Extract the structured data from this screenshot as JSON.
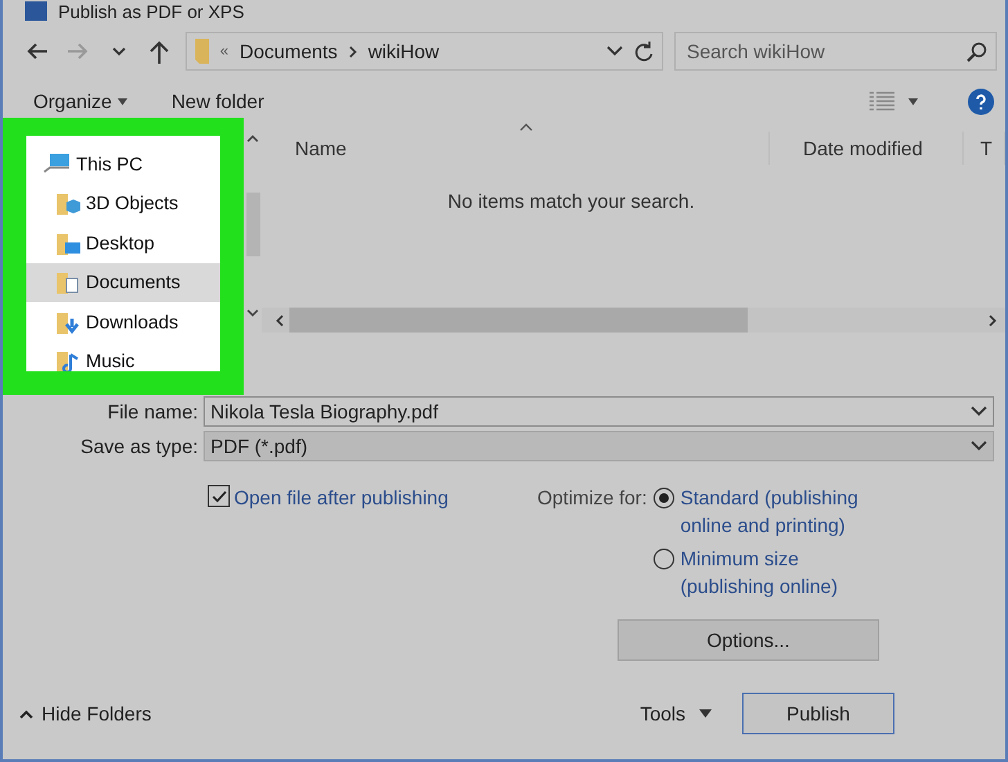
{
  "window": {
    "title": "Publish as PDF or XPS"
  },
  "address_bar": {
    "path": [
      "Documents",
      "wikiHow"
    ],
    "overflow": "«"
  },
  "search": {
    "placeholder": "Search wikiHow"
  },
  "toolbar": {
    "organize": "Organize",
    "new_folder": "New folder"
  },
  "nav_tree": {
    "label": "This PC",
    "children": [
      {
        "label": "3D Objects",
        "kind": "objects3d",
        "selected": false
      },
      {
        "label": "Desktop",
        "kind": "desktop",
        "selected": false
      },
      {
        "label": "Documents",
        "kind": "documents",
        "selected": true
      },
      {
        "label": "Downloads",
        "kind": "downloads",
        "selected": false
      },
      {
        "label": "Music",
        "kind": "music",
        "selected": false
      }
    ]
  },
  "file_list": {
    "columns": [
      "Name",
      "Date modified",
      "T"
    ],
    "empty_message": "No items match your search."
  },
  "file_name": {
    "label": "File name:",
    "value": "Nikola Tesla Biography.pdf"
  },
  "save_as_type": {
    "label": "Save as type:",
    "value": "PDF (*.pdf)"
  },
  "open_after": {
    "label": "Open file after publishing",
    "checked": true
  },
  "optimize": {
    "label": "Optimize for:",
    "options": [
      {
        "label": "Standard (publishing online and printing)",
        "selected": true
      },
      {
        "label": "Minimum size (publishing online)",
        "selected": false
      }
    ]
  },
  "options_button": "Options...",
  "hide_folders": "Hide Folders",
  "tools": "Tools",
  "publish_button": "Publish"
}
